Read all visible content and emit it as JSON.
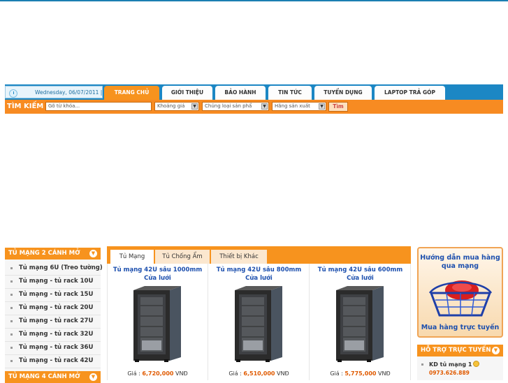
{
  "nav": {
    "date": "Wednesday, 06/07/2011 |",
    "tabs": [
      "TRANG CHỦ",
      "GIỚI THIỆU",
      "BẢO HÀNH",
      "TIN TỨC",
      "TUYỂN DỤNG",
      "LAPTOP TRẢ GÓP"
    ],
    "active_tab": 0
  },
  "search": {
    "label": "TÌM KIẾM",
    "keyword_placeholder": "Gõ từ khóa...",
    "price_select": "Khoảng giá",
    "type_select": "Chủng loại sản phẩ",
    "brand_select": "Hãng sản xuất",
    "button": "Tìm"
  },
  "left_menu": {
    "title": "TỦ MẠNG 2 CÁNH MỞ",
    "items": [
      "Tủ mạng 6U (Treo tường)",
      "Tủ mạng - tủ rack 10U",
      "Tủ mạng - tủ rack 15U",
      "Tủ mạng - tủ rack 20U",
      "Tủ mạng - tủ rack 27U",
      "Tủ mạng - tủ rack 32U",
      "Tủ mạng - tủ rack 36U",
      "Tủ mạng - tủ rack 42U"
    ],
    "next_title": "TỦ MẠNG 4 CÁNH MỞ"
  },
  "product_tabs": [
    "Tủ Mạng",
    "Tủ Chống Ẩm",
    "Thiết bị Khác"
  ],
  "products": [
    {
      "title": "Tủ mạng 42U sâu 1000mm Cửa lưới",
      "price_label": "Giá :",
      "price": "6,720,000",
      "currency": "VNĐ"
    },
    {
      "title": "Tủ mạng 42U sâu 800mm Cửa lưới",
      "price_label": "Giá :",
      "price": "6,510,000",
      "currency": "VNĐ"
    },
    {
      "title": "Tủ mạng 42U sâu 600mm Cửa lưới",
      "price_label": "Giá :",
      "price": "5,775,000",
      "currency": "VNĐ"
    }
  ],
  "banner": {
    "top": "Hướng dẫn mua hàng qua mạng",
    "bottom": "Mua hàng trực tuyến"
  },
  "support": {
    "title": "HỖ TRỢ TRỰC TUYẾN",
    "name": "KD tủ mạng 1",
    "phone": "0973.626.889"
  },
  "colors": {
    "accent": "#f7931e",
    "nav": "#1c87c4",
    "link": "#1c4fae",
    "price": "#e05a00"
  }
}
